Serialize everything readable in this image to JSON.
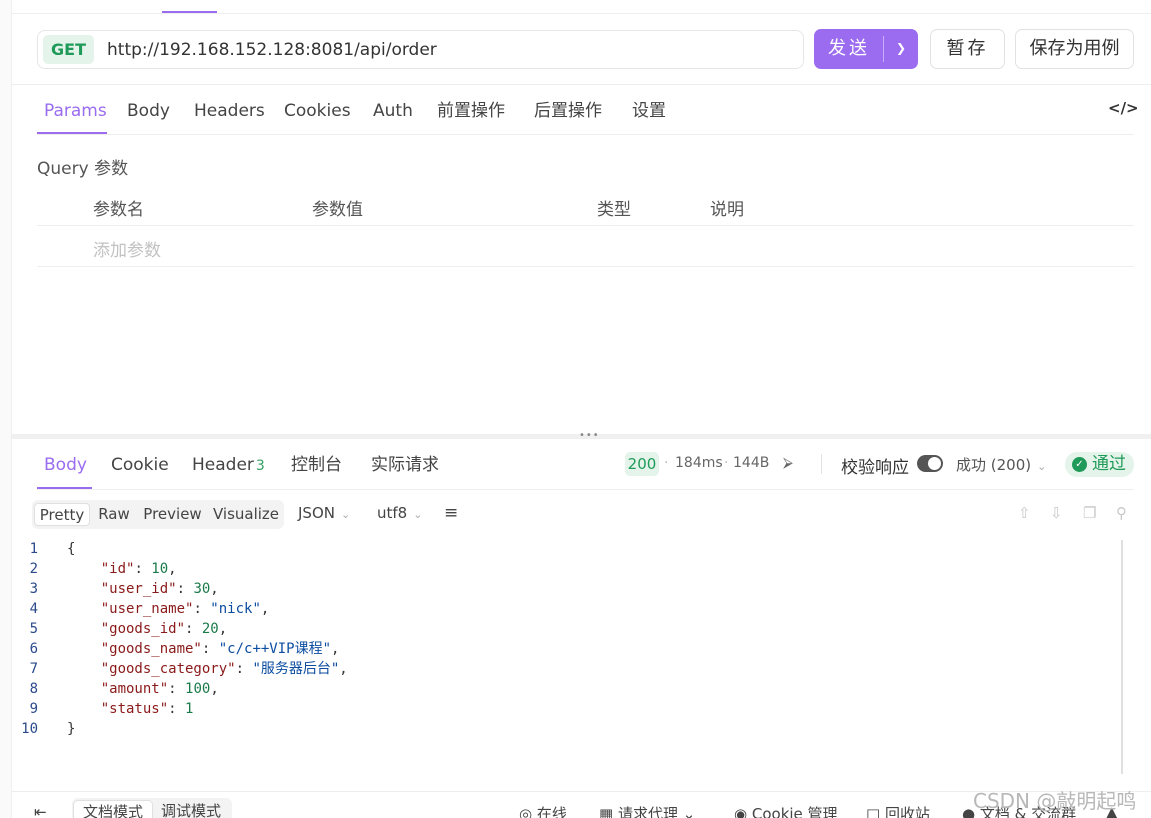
{
  "request": {
    "method": "GET",
    "url": "http://192.168.152.128:8081/api/order",
    "send_label": "发送",
    "save_label": "暂存",
    "save_case_label": "保存为用例",
    "code_toggle": "</>"
  },
  "request_tabs": [
    "Params",
    "Body",
    "Headers",
    "Cookies",
    "Auth",
    "前置操作",
    "后置操作",
    "设置"
  ],
  "query": {
    "title": "Query 参数",
    "columns": [
      "参数名",
      "参数值",
      "类型",
      "说明"
    ],
    "add_placeholder": "添加参数"
  },
  "response": {
    "tabs": [
      "Body",
      "Cookie",
      "Header",
      "控制台",
      "实际请求"
    ],
    "header_count": "3",
    "status_code": "200",
    "time": "184ms",
    "size": "144B",
    "verify_label": "校验响应",
    "verify_on": true,
    "success_select": "成功 (200)",
    "pass_label": "通过",
    "view_modes": [
      "Pretty",
      "Raw",
      "Preview",
      "Visualize"
    ],
    "format": "JSON",
    "encoding": "utf8"
  },
  "code_lines": [
    {
      "n": "1",
      "type": "open",
      "text": "{"
    },
    {
      "n": "2",
      "type": "kv",
      "key": "\"id\"",
      "val": "10",
      "vtype": "num",
      "comma": true
    },
    {
      "n": "3",
      "type": "kv",
      "key": "\"user_id\"",
      "val": "30",
      "vtype": "num",
      "comma": true
    },
    {
      "n": "4",
      "type": "kv",
      "key": "\"user_name\"",
      "val": "\"nick\"",
      "vtype": "str",
      "comma": true
    },
    {
      "n": "5",
      "type": "kv",
      "key": "\"goods_id\"",
      "val": "20",
      "vtype": "num",
      "comma": true
    },
    {
      "n": "6",
      "type": "kv",
      "key": "\"goods_name\"",
      "val": "\"c/c++VIP课程\"",
      "vtype": "str",
      "comma": true
    },
    {
      "n": "7",
      "type": "kv",
      "key": "\"goods_category\"",
      "val": "\"服务器后台\"",
      "vtype": "str",
      "comma": true
    },
    {
      "n": "8",
      "type": "kv",
      "key": "\"amount\"",
      "val": "100",
      "vtype": "num",
      "comma": true
    },
    {
      "n": "9",
      "type": "kv",
      "key": "\"status\"",
      "val": "1",
      "vtype": "num",
      "comma": false
    },
    {
      "n": "10",
      "type": "close",
      "text": "}"
    }
  ],
  "bottom_bar": {
    "doc_mode": "文档模式",
    "debug_mode": "调试模式",
    "online": "在线",
    "proxy": "请求代理",
    "cookie_mgr": "Cookie 管理",
    "recycle": "回收站",
    "docs": "文档 & 交流群"
  },
  "watermark": "CSDN @敲明起鸣",
  "colors": {
    "accent": "#9c6cf0",
    "success": "#1f9a58",
    "success_bg": "#e4f4ea"
  }
}
